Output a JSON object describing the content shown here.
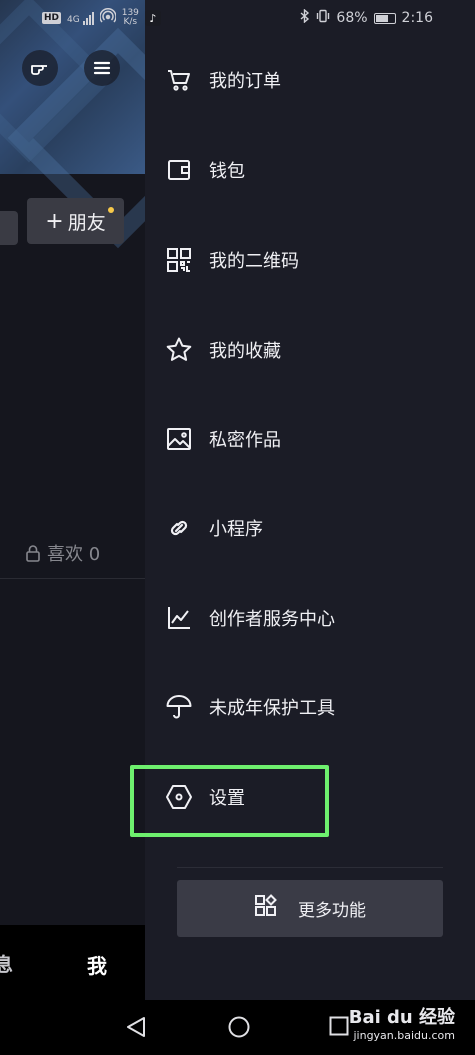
{
  "status_bar": {
    "left_tags": [
      "HD",
      "4G"
    ],
    "net_speed_value": "139",
    "net_speed_unit": "K/s",
    "battery": "68%",
    "battery_level": 0.68,
    "time": "2:16"
  },
  "profile": {
    "friend_button": "朋友",
    "likes_tab": "喜欢 0",
    "nav_messages": "息",
    "nav_me": "我"
  },
  "drawer": {
    "items": [
      {
        "label": "我的订单",
        "icon": "shopping-cart-icon"
      },
      {
        "label": "钱包",
        "icon": "wallet-icon"
      },
      {
        "label": "我的二维码",
        "icon": "qr-code-icon"
      },
      {
        "label": "我的收藏",
        "icon": "star-icon"
      },
      {
        "label": "私密作品",
        "icon": "image-icon"
      },
      {
        "label": "小程序",
        "icon": "link-icon"
      },
      {
        "label": "创作者服务中心",
        "icon": "chart-line-icon"
      },
      {
        "label": "未成年保护工具",
        "icon": "umbrella-icon"
      },
      {
        "label": "设置",
        "icon": "hexagon-settings-icon"
      }
    ],
    "more_button": "更多功能"
  },
  "watermark": {
    "brand": "Bai du 经验",
    "url": "jingyan.baidu.com"
  },
  "colors": {
    "drawer_bg": "#1b1c26",
    "highlight": "#6ef06e",
    "notification_dot": "#f7c94a"
  }
}
